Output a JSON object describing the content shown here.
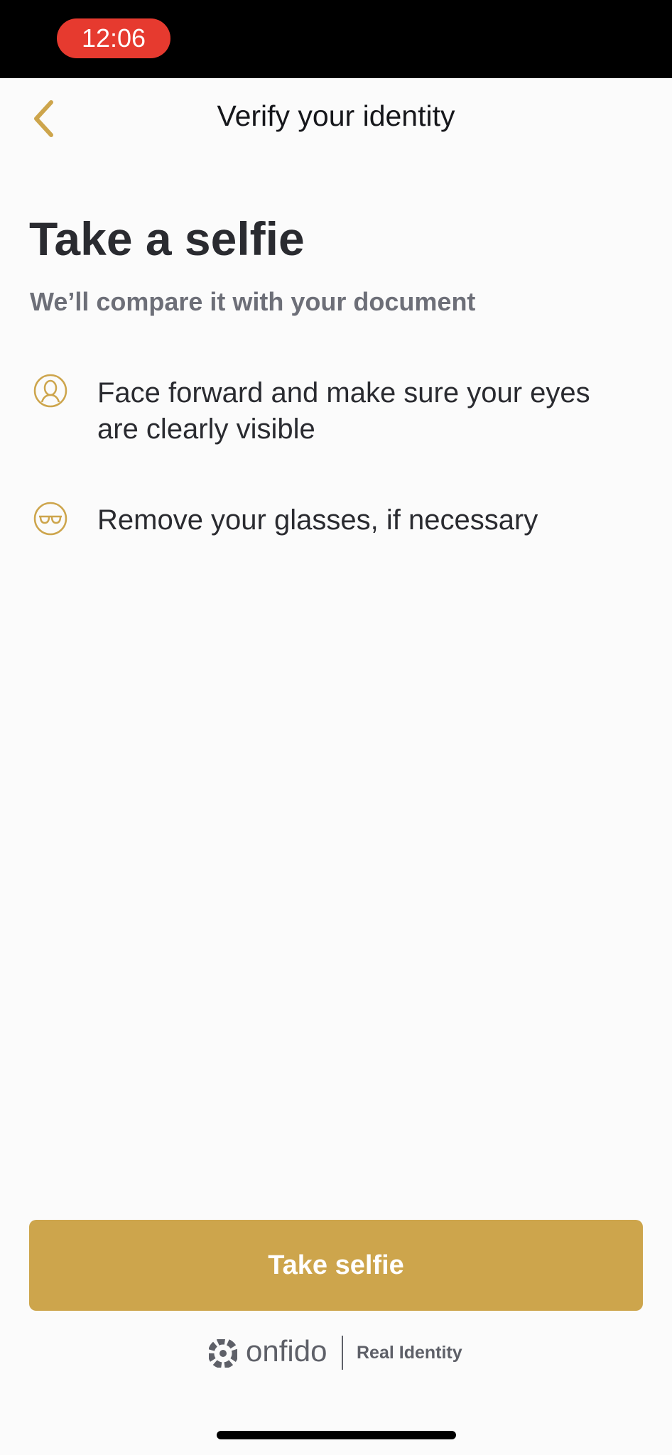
{
  "status_bar": {
    "time": "12:06"
  },
  "nav": {
    "title": "Verify your identity",
    "back_icon": "chevron-left-icon"
  },
  "content": {
    "title": "Take a selfie",
    "subtitle": "We’ll compare it with your document",
    "instructions": [
      {
        "icon": "face-icon",
        "text": "Face forward and make sure your eyes are clearly visible"
      },
      {
        "icon": "glasses-icon",
        "text": "Remove your glasses, if necessary"
      }
    ]
  },
  "actions": {
    "primary_label": "Take selfie"
  },
  "footer": {
    "brand": "onfido",
    "tagline": "Real Identity"
  },
  "colors": {
    "accent": "#cda54c",
    "status_pill": "#e63a2f"
  }
}
